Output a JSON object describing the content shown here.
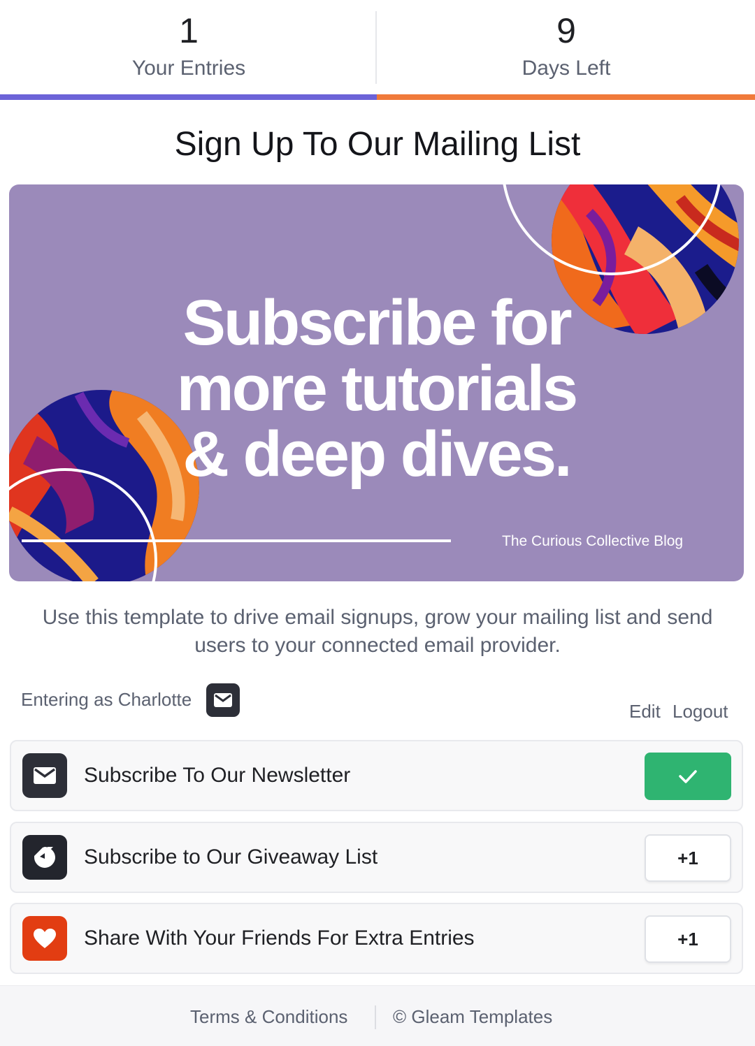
{
  "stats": {
    "entries_value": "1",
    "entries_label": "Your Entries",
    "days_value": "9",
    "days_label": "Days Left"
  },
  "colors": {
    "entries_bar": "#6c63d8",
    "days_bar": "#f07a3a",
    "banner_bg": "#9b8aba",
    "done_green": "#2fb471",
    "giveaway_icon_bg": "#23252d",
    "share_icon_bg": "#e23d12"
  },
  "title": "Sign Up To Our Mailing List",
  "banner": {
    "headline_line1": "Subscribe for",
    "headline_line2": "more tutorials",
    "headline_line3": "& deep dives.",
    "blog_name": "The Curious Collective Blog"
  },
  "description": "Use this template to drive email signups, grow your mailing list and send users to your connected email provider.",
  "user": {
    "entering_as": "Entering as Charlotte",
    "entering_icon": "envelope-icon",
    "edit_label": "Edit",
    "logout_label": "Logout"
  },
  "entries": [
    {
      "label": "Subscribe To Our Newsletter",
      "icon": "envelope-icon",
      "status": "completed",
      "button_label": ""
    },
    {
      "label": "Subscribe to Our Giveaway List",
      "icon": "giveaway-logo-icon",
      "status": "pending",
      "button_label": "+1"
    },
    {
      "label": "Share With Your Friends For Extra Entries",
      "icon": "heart-icon",
      "status": "pending",
      "button_label": "+1"
    }
  ],
  "footer": {
    "terms_label": "Terms & Conditions",
    "copyright_label": "© Gleam Templates"
  }
}
